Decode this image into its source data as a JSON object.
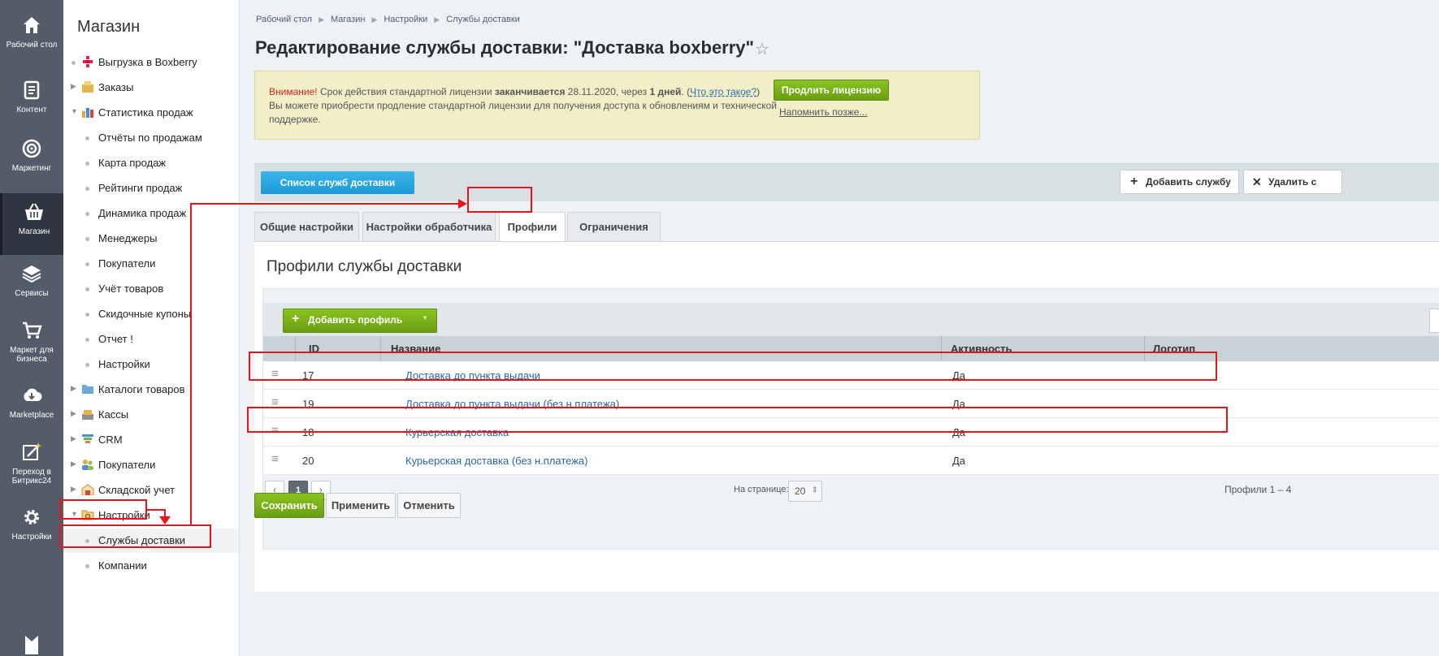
{
  "leftbar": {
    "items": [
      {
        "label": "Рабочий стол",
        "icon": "home-icon"
      },
      {
        "label": "Контент",
        "icon": "document-icon"
      },
      {
        "label": "Маркетинг",
        "icon": "target-icon"
      },
      {
        "label": "Магазин",
        "icon": "basket-icon"
      },
      {
        "label": "Сервисы",
        "icon": "layers-icon"
      },
      {
        "label": "Маркет для бизнеса",
        "icon": "cart-icon"
      },
      {
        "label": "Marketplace",
        "icon": "cloud-download-icon"
      },
      {
        "label": "Переход в Битрикс24",
        "icon": "magic-icon"
      },
      {
        "label": "Настройки",
        "icon": "gear-icon"
      }
    ]
  },
  "sidebar": {
    "title": "Магазин",
    "items": [
      {
        "label": "Выгрузка в Boxberry"
      },
      {
        "label": "Заказы"
      },
      {
        "label": "Статистика продаж"
      },
      {
        "label": "Отчёты по продажам"
      },
      {
        "label": "Карта продаж"
      },
      {
        "label": "Рейтинги продаж"
      },
      {
        "label": "Динамика продаж"
      },
      {
        "label": "Менеджеры"
      },
      {
        "label": "Покупатели"
      },
      {
        "label": "Учёт товаров"
      },
      {
        "label": "Скидочные купоны"
      },
      {
        "label": "Отчет !"
      },
      {
        "label": "Настройки"
      },
      {
        "label": "Каталоги товаров"
      },
      {
        "label": "Кассы"
      },
      {
        "label": "CRM"
      },
      {
        "label": "Покупатели"
      },
      {
        "label": "Складской учет"
      },
      {
        "label": "Настройки"
      },
      {
        "label": "Службы доставки"
      },
      {
        "label": "Компании"
      }
    ]
  },
  "breadcrumbs": [
    "Рабочий стол",
    "Магазин",
    "Настройки",
    "Службы доставки"
  ],
  "page_title": "Редактирование службы доставки: \"Доставка boxberry\"",
  "notice": {
    "warning": "Внимание!",
    "text1": " Срок действия стандартной лицензии ",
    "bold1": "заканчивается",
    "text2": " 28.11.2020, через ",
    "bold2": "1 дней",
    "text3": ". (",
    "link": "Что это такое?",
    "text4": ")",
    "line2": "Вы можете приобрести продление стандартной лицензии для получения доступа к обновлениям и технической поддержке.",
    "renew_button": "Продлить лицензию",
    "remind_link": "Напомнить позже..."
  },
  "toolbar": {
    "list_button": "Список служб доставки",
    "add_button": "Добавить службу",
    "delete_button": "Удалить с"
  },
  "tabs": [
    "Общие настройки",
    "Настройки обработчика",
    "Профили",
    "Ограничения"
  ],
  "panel_title": "Профили службы доставки",
  "grid": {
    "add_profile_button": "Добавить профиль",
    "columns": [
      "ID",
      "Название",
      "Активность",
      "Логотип"
    ],
    "rows": [
      {
        "id": "17",
        "name": "Доставка до пункта выдачи",
        "active": "Да"
      },
      {
        "id": "19",
        "name": "Доставка до пункта выдачи (без н.платежа)",
        "active": "Да"
      },
      {
        "id": "18",
        "name": "Курьерская доставка",
        "active": "Да"
      },
      {
        "id": "20",
        "name": "Курьерская доставка (без н.платежа)",
        "active": "Да"
      }
    ],
    "pager": {
      "prev": "‹",
      "current": "1",
      "next": "›",
      "per_page_label": "На странице:",
      "per_page_value": "20",
      "summary": "Профили 1 – 4"
    }
  },
  "footer": {
    "save": "Сохранить",
    "apply": "Применить",
    "cancel": "Отменить"
  },
  "colors": {
    "highlight": "#e8141a",
    "green": "#7ab317",
    "blue": "#22a3de"
  }
}
